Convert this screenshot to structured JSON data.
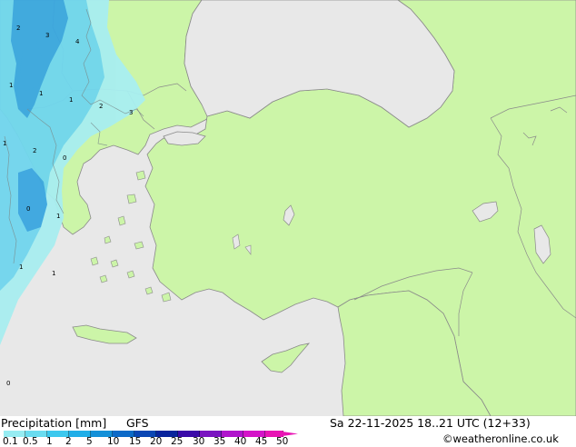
{
  "title": "Precipitation [mm]",
  "model": "GFS",
  "valid_time": "Sa 22-11-2025 18..21 UTC (12+33)",
  "credit": "©weatheronline.co.uk",
  "colors": {
    "sea": "#e8e8e8",
    "land": "#ccf5a8",
    "coast": "#8a8a8a",
    "precip_light": "#a8eef0",
    "precip_medium": "#70d6ee",
    "precip_heavy": "#3aa6e0"
  },
  "legend": {
    "labels": [
      "0.1",
      "0.5",
      "1",
      "2",
      "5",
      "10",
      "15",
      "20",
      "25",
      "30",
      "35",
      "40",
      "45",
      "50"
    ],
    "colors": [
      "#c6f6f8",
      "#96ecf2",
      "#6adcf0",
      "#3cc8ee",
      "#20aee8",
      "#1490d8",
      "#0c6ac8",
      "#0a46b4",
      "#08249c",
      "#3a0aa8",
      "#7a14c0",
      "#b014cc",
      "#d414c8",
      "#e814b4"
    ]
  },
  "precip_labels": [
    "2",
    "3",
    "4",
    "1",
    "1",
    "1",
    "2",
    "3",
    "1",
    "2",
    "0",
    "0",
    "1",
    "1",
    "1",
    "0"
  ]
}
